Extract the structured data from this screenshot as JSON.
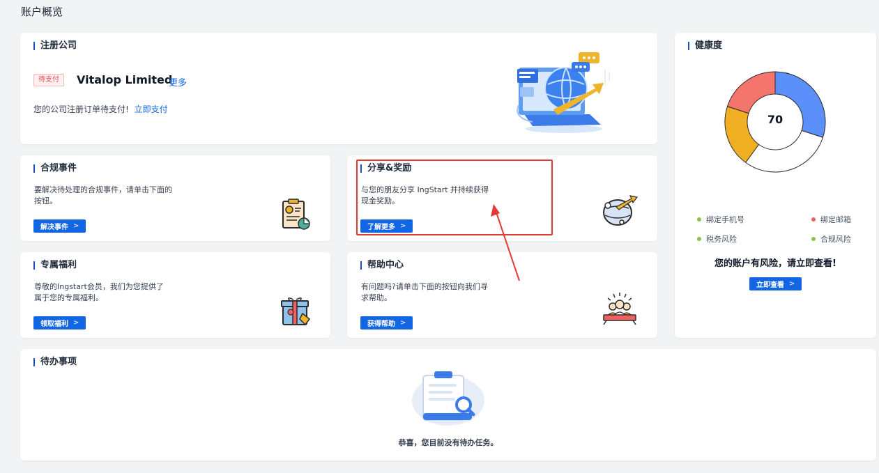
{
  "page": {
    "title": "账户概览"
  },
  "registration": {
    "title": "注册公司",
    "badge": "待支付",
    "company_name": "Vitalop Limited",
    "more_label": "更多",
    "message": "您的公司注册订单待支付!",
    "pay_link": "立即支付"
  },
  "compliance": {
    "title": "合规事件",
    "description": "要解决待处理的合规事件，请单击下面的按钮。",
    "button": "解决事件"
  },
  "share": {
    "title": "分享&奖励",
    "description": "与您的朋友分享 IngStart 并持续获得现金奖励。",
    "button": "了解更多"
  },
  "benefits": {
    "title": "专属福利",
    "description": "尊敬的Ingstart会员，我们为您提供了属于您的专属福利。",
    "button": "领取福利"
  },
  "help": {
    "title": "帮助中心",
    "description": "有问题吗?请单击下面的按钮向我们寻求帮助。",
    "button": "获得帮助"
  },
  "health": {
    "title": "健康度",
    "score": "70",
    "legend": [
      {
        "label": "绑定手机号",
        "color": "#8bc34a"
      },
      {
        "label": "绑定邮箱",
        "color": "#f06262"
      },
      {
        "label": "税务风险",
        "color": "#8bc34a"
      },
      {
        "label": "合规风险",
        "color": "#8bc34a"
      }
    ],
    "risk_message": "您的账户有风险，请立即查看!",
    "check_button": "立即查看",
    "segments": [
      {
        "value": 30,
        "color": "#5b8ff9"
      },
      {
        "value": 30,
        "color": "#ffffff"
      },
      {
        "value": 20,
        "color": "#f0ae22"
      },
      {
        "value": 20,
        "color": "#f4756b"
      }
    ]
  },
  "todo": {
    "title": "待办事项",
    "empty_message": "恭喜，您目前没有待办任务。"
  },
  "colors": {
    "primary": "#1266e3",
    "accent_bar": "#1e4fc6",
    "highlight": "#e53935"
  }
}
